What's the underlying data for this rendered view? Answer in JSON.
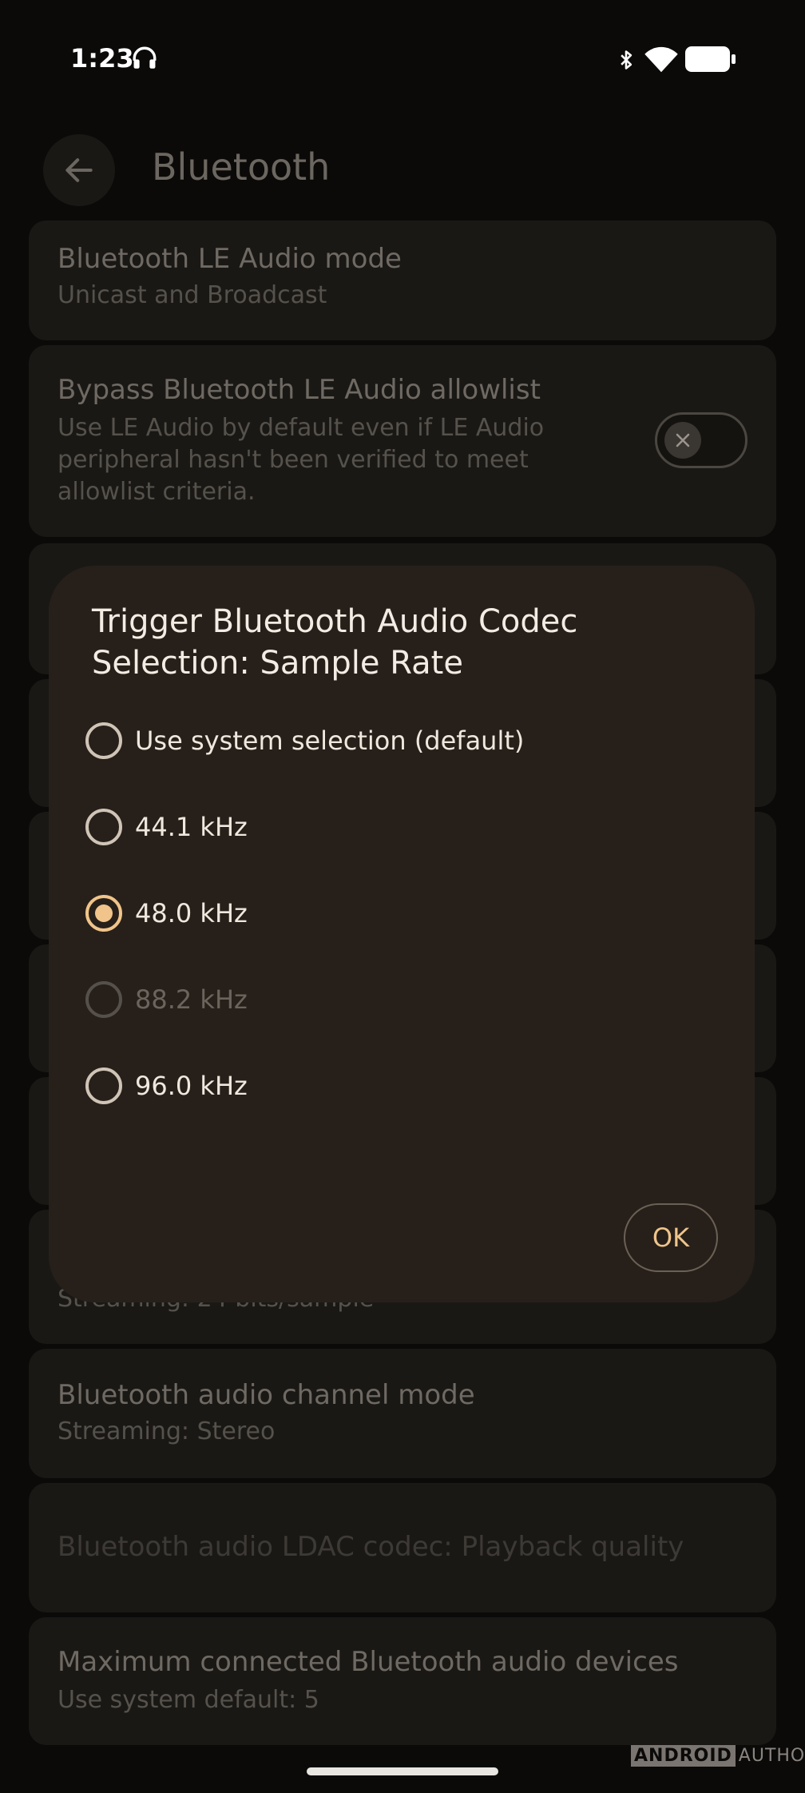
{
  "status_bar": {
    "time": "1:23",
    "icons": [
      "headphones-icon",
      "bluetooth-icon",
      "wifi-icon",
      "battery-icon"
    ]
  },
  "app_bar": {
    "title": "Bluetooth",
    "back_icon": "arrow-back-icon"
  },
  "settings": [
    {
      "title": "Bluetooth LE Audio mode",
      "summary": "Unicast and Broadcast"
    },
    {
      "title": "Bypass Bluetooth LE Audio allowlist",
      "summary_lines": [
        "Use LE Audio by default even if LE Audio",
        "peripheral hasn't been verified to meet",
        "allowlist criteria."
      ],
      "toggle_on": false
    },
    {
      "title": "",
      "summary": "Streaming: 24 bits/sample"
    },
    {
      "title": "Bluetooth audio channel mode",
      "summary": "Streaming: Stereo"
    },
    {
      "title": "Bluetooth audio LDAC codec: Playback quality"
    },
    {
      "title": "Maximum connected Bluetooth audio devices",
      "summary": "Use system default: 5"
    }
  ],
  "dialog": {
    "title": "Trigger Bluetooth Audio Codec Selection: Sample Rate",
    "options": [
      {
        "label": "Use system selection (default)",
        "selected": false,
        "enabled": true
      },
      {
        "label": "44.1 kHz",
        "selected": false,
        "enabled": true
      },
      {
        "label": "48.0 kHz",
        "selected": true,
        "enabled": true
      },
      {
        "label": "88.2 kHz",
        "selected": false,
        "enabled": false
      },
      {
        "label": "96.0 kHz",
        "selected": false,
        "enabled": true
      }
    ],
    "ok_label": "OK"
  },
  "watermark": {
    "boxed": "ANDROID",
    "text": "AUTHORITY"
  },
  "colors": {
    "accent": "#f0c48a",
    "dialog_bg": "#27201a",
    "card_bg": "#1a1815"
  }
}
